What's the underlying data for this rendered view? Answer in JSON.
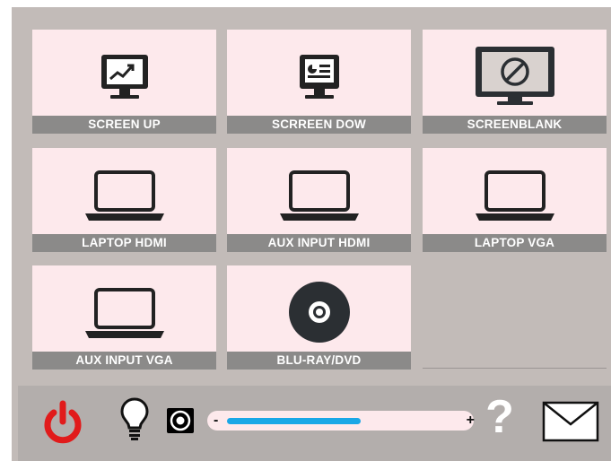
{
  "tiles": [
    {
      "label": "SCREEN UP",
      "icon": "monitor-chart-icon"
    },
    {
      "label": "SCRREEN DOW",
      "icon": "monitor-presentation-icon"
    },
    {
      "label": "SCREENBLANK",
      "icon": "monitor-blank-icon"
    },
    {
      "label": "LAPTOP HDMI",
      "icon": "laptop-icon"
    },
    {
      "label": "AUX INPUT HDMI",
      "icon": "laptop-icon"
    },
    {
      "label": "LAPTOP VGA",
      "icon": "laptop-icon"
    },
    {
      "label": "AUX  INPUT VGA",
      "icon": "laptop-icon"
    },
    {
      "label": "BLU-RAY/DVD",
      "icon": "disc-icon"
    }
  ],
  "controls": {
    "power": {
      "icon": "power-icon",
      "color": "#e11b1b"
    },
    "lightbulb": {
      "icon": "lightbulb-icon"
    },
    "speaker": {
      "icon": "speaker-icon"
    },
    "volume": {
      "minus_label": "-",
      "plus_label": "+",
      "level": 0.55,
      "fill_color": "#1aa7e6"
    },
    "help": {
      "icon": "question-mark-icon",
      "label": "?"
    },
    "mail": {
      "icon": "envelope-icon"
    }
  }
}
